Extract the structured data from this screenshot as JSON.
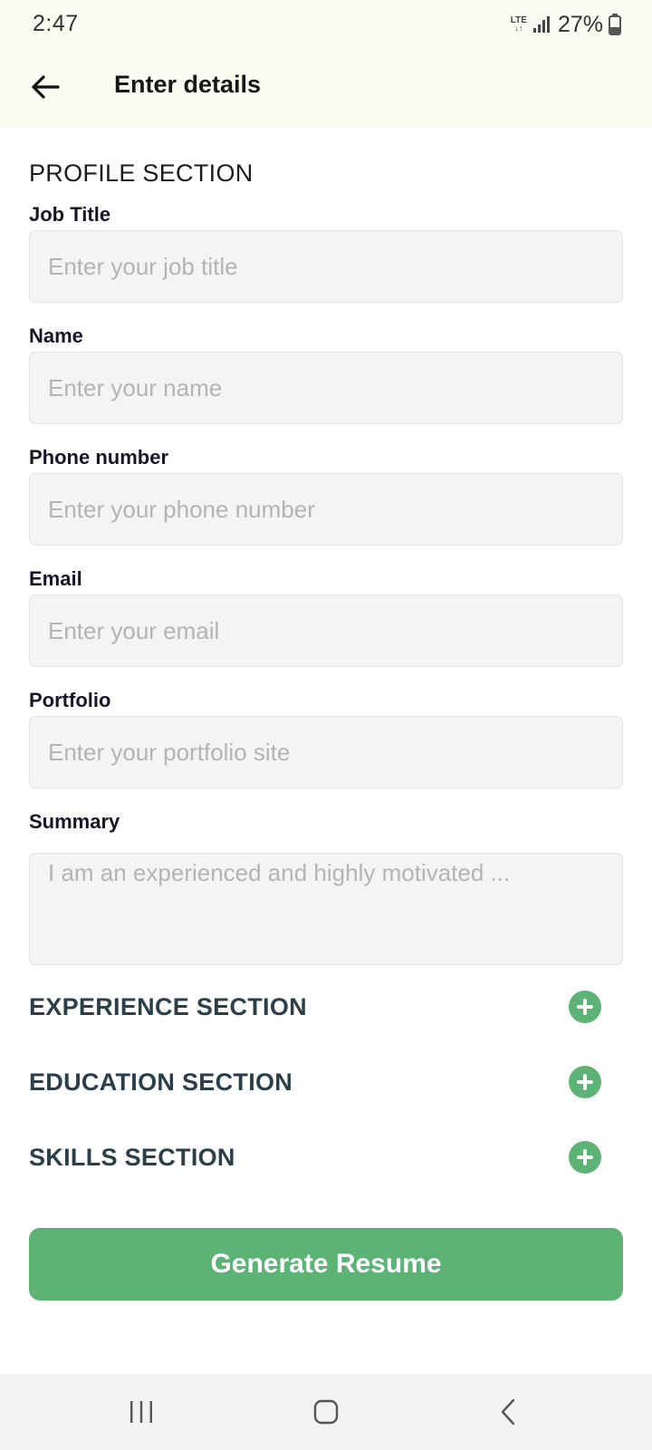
{
  "status_bar": {
    "time": "2:47",
    "network": "LTE",
    "battery": "27%"
  },
  "app_bar": {
    "back_icon": "arrow-left-icon",
    "title": "Enter details"
  },
  "profile": {
    "section_title": "PROFILE SECTION",
    "fields": [
      {
        "label": "Job Title",
        "placeholder": "Enter your job title",
        "value": ""
      },
      {
        "label": "Name",
        "placeholder": "Enter your name",
        "value": ""
      },
      {
        "label": "Phone number",
        "placeholder": "Enter your phone number",
        "value": ""
      },
      {
        "label": "Email",
        "placeholder": "Enter your email",
        "value": ""
      },
      {
        "label": "Portfolio",
        "placeholder": "Enter your portfolio site",
        "value": ""
      }
    ],
    "summary": {
      "label": "Summary",
      "placeholder": "I am an experienced and highly motivated ...",
      "value": ""
    }
  },
  "sections": [
    {
      "label": "EXPERIENCE SECTION",
      "icon": "plus-circle-icon"
    },
    {
      "label": "EDUCATION SECTION",
      "icon": "plus-circle-icon"
    },
    {
      "label": "SKILLS SECTION",
      "icon": "plus-circle-icon"
    }
  ],
  "primary_button": {
    "label": "Generate Resume"
  },
  "colors": {
    "accent": "#5db276",
    "header_bg": "#f8fcf1",
    "input_bg": "#f4f4f4",
    "section_text": "#2b3f4b"
  },
  "nav_bar": {
    "items": [
      "recent-apps-icon",
      "home-icon",
      "back-chevron-icon"
    ]
  }
}
